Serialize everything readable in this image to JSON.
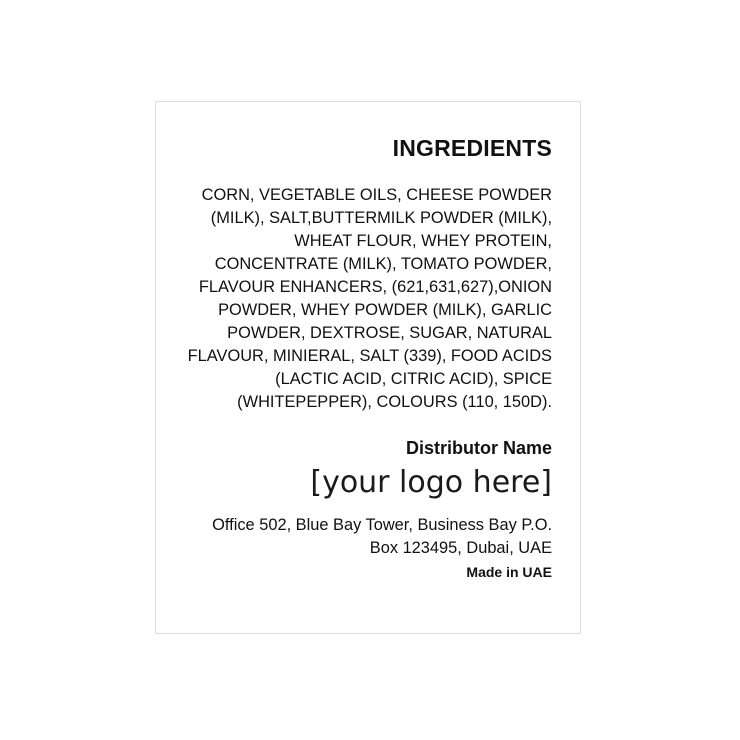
{
  "label": {
    "title": "INGREDIENTS",
    "ingredient_lines": [
      "CORN, VEGETABLE OILS, CHEESE POWDER",
      "(MILK), SALT,BUTTERMILK POWDER (MILK),",
      "WHEAT FLOUR, WHEY PROTEIN,",
      "CONCENTRATE (MILK), TOMATO POWDER,",
      "FLAVOUR ENHANCERS, (621,631,627),ONION",
      "POWDER, WHEY POWDER (MILK), GARLIC",
      "POWDER, DEXTROSE, SUGAR, NATURAL",
      "FLAVOUR, MINIERAL, SALT (339), FOOD ACIDS",
      "(LACTIC ACID, CITRIC ACID), SPICE",
      "(WHITEPEPPER), COLOURS (110, 150D)."
    ],
    "distributor_heading": "Distributor Name",
    "logo_placeholder": "[your logo here]",
    "address_lines": [
      "Office 502, Blue Bay Tower, Business Bay P.O.",
      "Box 123495, Dubai, UAE"
    ],
    "origin": "Made in UAE"
  },
  "colors": {
    "text": "#111111",
    "border": "#dcdcdc",
    "background": "#ffffff"
  }
}
